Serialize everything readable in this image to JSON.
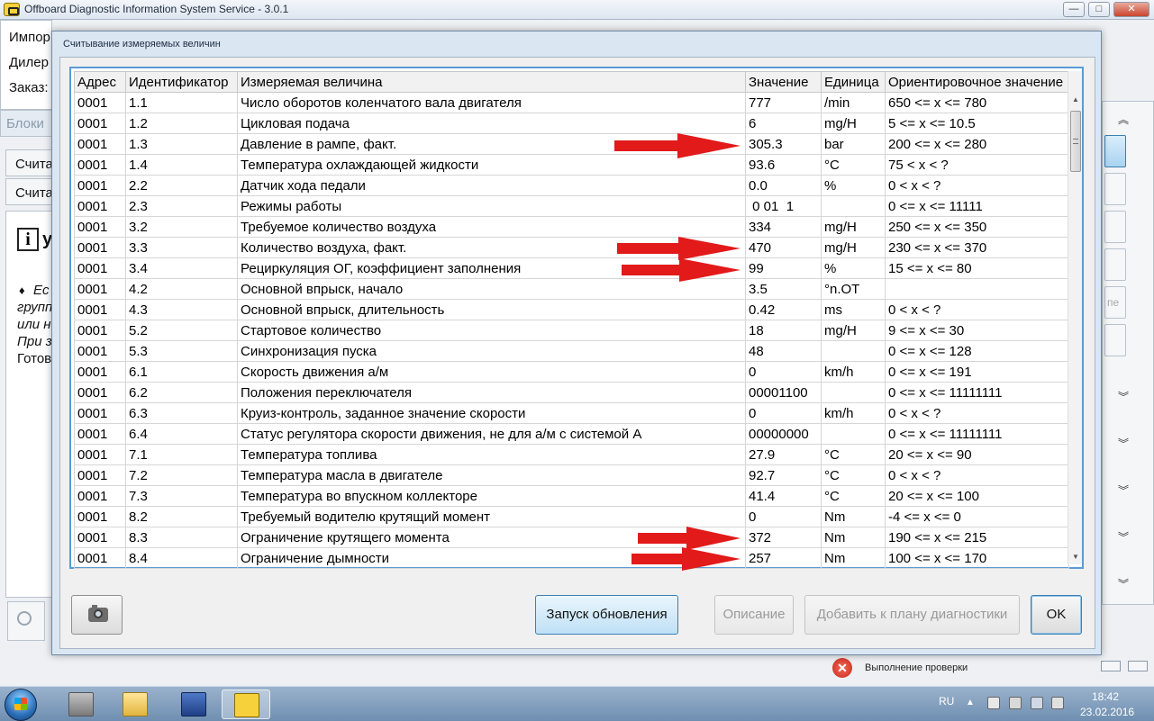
{
  "app": {
    "title": "Offboard Diagnostic Information System Service - 3.0.1",
    "min": "—",
    "max": "□",
    "close": "✕"
  },
  "background": {
    "labels": [
      "Импор",
      "Дилер",
      "Заказ:"
    ],
    "blocks_tab": "Блоки",
    "read_items": [
      "Счита",
      "Счита"
    ],
    "info_heading": "у",
    "info_lines": [
      "Ес",
      "групп",
      "или н",
      "При з",
      "Готов"
    ],
    "side_button_text": "пе"
  },
  "status": {
    "text": "Выполнение проверки"
  },
  "dialog": {
    "title": "Считывание измеряемых величин",
    "columns": [
      "Адрес",
      "Идентификатор",
      "Измеряемая величина",
      "Значение",
      "Единица",
      "Ориентировочное значение"
    ],
    "rows": [
      [
        "0001",
        "1.1",
        "Число оборотов коленчатого вала двигателя",
        "777",
        "/min",
        "650 <= x <= 780"
      ],
      [
        "0001",
        "1.2",
        "Цикловая подача",
        "6",
        "mg/H",
        "5 <= x <= 10.5"
      ],
      [
        "0001",
        "1.3",
        "Давление в рампе, факт.",
        "305.3",
        "bar",
        "200 <= x <= 280"
      ],
      [
        "0001",
        "1.4",
        "Температура охлаждающей жидкости",
        "93.6",
        "°C",
        "75 < x < ?"
      ],
      [
        "0001",
        "2.2",
        "Датчик хода педали",
        "0.0",
        "%",
        "0 < x < ?"
      ],
      [
        "0001",
        "2.3",
        "Режимы работы",
        " 0 01  1",
        "",
        "0 <= x <= 11111"
      ],
      [
        "0001",
        "3.2",
        "Требуемое количество воздуха",
        "334",
        "mg/H",
        "250 <= x <= 350"
      ],
      [
        "0001",
        "3.3",
        "Количество воздуха, факт.",
        "470",
        "mg/H",
        "230 <= x <= 370"
      ],
      [
        "0001",
        "3.4",
        "Рециркуляция ОГ, коэффициент заполнения",
        "99",
        "%",
        "15 <= x <= 80"
      ],
      [
        "0001",
        "4.2",
        "Основной впрыск, начало",
        "3.5",
        "°n.OT",
        ""
      ],
      [
        "0001",
        "4.3",
        "Основной впрыск, длительность",
        "0.42",
        "ms",
        "0 < x < ?"
      ],
      [
        "0001",
        "5.2",
        "Стартовое количество",
        "18",
        "mg/H",
        "9 <= x <= 30"
      ],
      [
        "0001",
        "5.3",
        "Синхронизация пуска",
        "48",
        "",
        "0 <= x <= 128"
      ],
      [
        "0001",
        "6.1",
        "Скорость движения а/м",
        "0",
        "km/h",
        "0 <= x <= 191"
      ],
      [
        "0001",
        "6.2",
        "Положения переключателя",
        "00001100",
        "",
        "0 <= x <= 11111111"
      ],
      [
        "0001",
        "6.3",
        "Круиз-контроль, заданное значение скорости",
        "0",
        "km/h",
        "0 < x < ?"
      ],
      [
        "0001",
        "6.4",
        "Статус регулятора скорости движения, не для а/м с системой А",
        "00000000",
        "",
        "0 <= x <= 11111111"
      ],
      [
        "0001",
        "7.1",
        "Температура топлива",
        "27.9",
        "°C",
        "20 <= x <= 90"
      ],
      [
        "0001",
        "7.2",
        "Температура масла в двигателе",
        "92.7",
        "°C",
        "0 < x < ?"
      ],
      [
        "0001",
        "7.3",
        "Температура во впускном коллекторе",
        "41.4",
        "°C",
        "20 <= x <= 100"
      ],
      [
        "0001",
        "8.2",
        "Требуемый водителю крутящий момент",
        "0",
        "Nm",
        "-4 <= x <= 0"
      ],
      [
        "0001",
        "8.3",
        "Ограничение крутящего момента",
        "372",
        "Nm",
        "190 <= x <= 215"
      ],
      [
        "0001",
        "8.4",
        "Ограничение дымности",
        "257",
        "Nm",
        "100 <= x <= 170"
      ]
    ],
    "buttons": {
      "refresh": "Запуск обновления",
      "description": "Описание",
      "add_to_plan": "Добавить к плану диагностики",
      "ok": "OK"
    },
    "annotation_color": "#e21a1a"
  },
  "taskbar": {
    "language": "RU",
    "time": "18:42",
    "date": "23.02.2016"
  }
}
